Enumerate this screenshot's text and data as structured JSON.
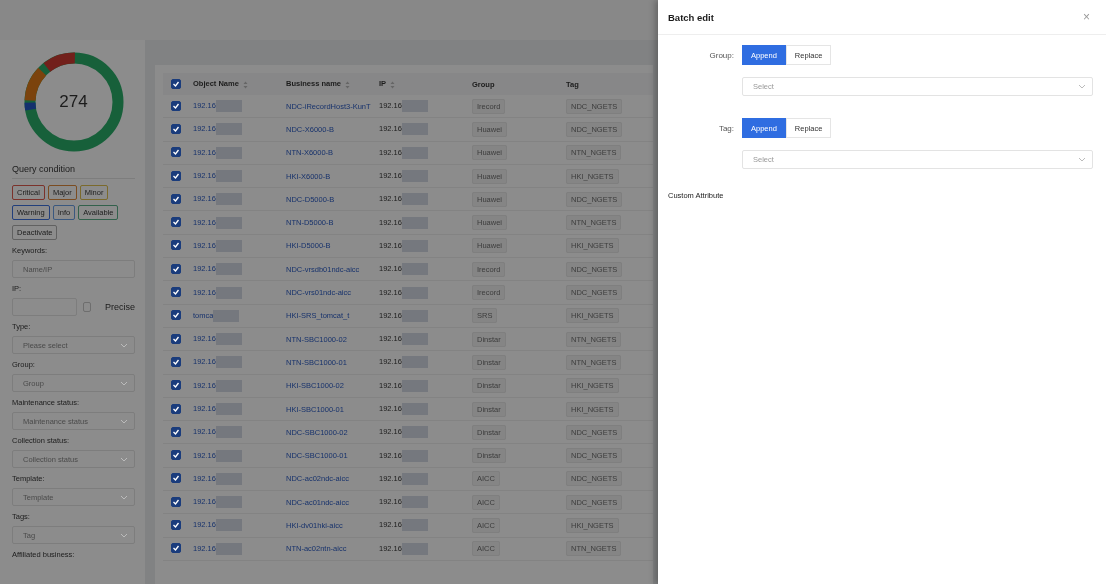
{
  "sidebar": {
    "total": "274",
    "query_title": "Query condition",
    "levels": [
      {
        "label": "Critical",
        "color": "#7b322b"
      },
      {
        "label": "Major",
        "color": "#7b4c21"
      },
      {
        "label": "Minor",
        "color": "#7b6a2c"
      },
      {
        "label": "Warning",
        "color": "#223f7b"
      },
      {
        "label": "Info",
        "color": "#3a587f"
      },
      {
        "label": "Available",
        "color": "#32614c"
      },
      {
        "label": "Deactivate",
        "color": "#616161"
      }
    ],
    "fields": [
      {
        "label": "Keywords:",
        "kind": "input",
        "placeholder": "Name/IP"
      },
      {
        "label": "IP:",
        "kind": "ip",
        "precise_label": "Precise",
        "precise_checked": false
      },
      {
        "label": "Type:",
        "kind": "select",
        "placeholder": "Please select"
      },
      {
        "label": "Group:",
        "kind": "select",
        "placeholder": "Group"
      },
      {
        "label": "Maintenance status:",
        "kind": "select",
        "placeholder": "Maintenance status"
      },
      {
        "label": "Collection status:",
        "kind": "select",
        "placeholder": "Collection status"
      },
      {
        "label": "Template:",
        "kind": "select",
        "placeholder": "Template"
      },
      {
        "label": "Tags:",
        "kind": "select",
        "placeholder": "Tag"
      },
      {
        "label": "Affiliated business:",
        "kind": "label"
      }
    ]
  },
  "table": {
    "all_checked": true,
    "columns": [
      {
        "label": "Object Name",
        "sortable": true
      },
      {
        "label": "Business name",
        "sortable": true
      },
      {
        "label": "IP",
        "sortable": true
      },
      {
        "label": "Group",
        "sortable": false
      },
      {
        "label": "Tag",
        "sortable": false
      }
    ],
    "rows": [
      {
        "selected": true,
        "object": "192.16",
        "business": "NDC-iRecordHost3-KunT",
        "ip": "192.16",
        "group": "Irecord",
        "tag": "NDC_NGETS"
      },
      {
        "selected": true,
        "object": "192.16",
        "business": "NDC-X6000-B",
        "ip": "192.16",
        "group": "Huawei",
        "tag": "NDC_NGETS"
      },
      {
        "selected": true,
        "object": "192.16",
        "business": "NTN-X6000-B",
        "ip": "192.16",
        "group": "Huawei",
        "tag": "NTN_NGETS"
      },
      {
        "selected": true,
        "object": "192.16",
        "business": "HKI-X6000-B",
        "ip": "192.16",
        "group": "Huawei",
        "tag": "HKI_NGETS"
      },
      {
        "selected": true,
        "object": "192.16",
        "business": "NDC-D5000-B",
        "ip": "192.16",
        "group": "Huawei",
        "tag": "NDC_NGETS"
      },
      {
        "selected": true,
        "object": "192.16",
        "business": "NTN-D5000-B",
        "ip": "192.16",
        "group": "Huawei",
        "tag": "NTN_NGETS"
      },
      {
        "selected": true,
        "object": "192.16",
        "business": "HKI-D5000-B",
        "ip": "192.16",
        "group": "Huawei",
        "tag": "HKI_NGETS"
      },
      {
        "selected": true,
        "object": "192.16",
        "business": "NDC-vrsdb01ndc-aicc",
        "ip": "192.16",
        "group": "Irecord",
        "tag": "NDC_NGETS"
      },
      {
        "selected": true,
        "object": "192.16",
        "business": "NDC-vrs01ndc-aicc",
        "ip": "192.16",
        "group": "Irecord",
        "tag": "NDC_NGETS"
      },
      {
        "selected": true,
        "object": "tomca",
        "business": "HKI-SRS_tomcat_t",
        "ip": "192.16",
        "group": "SRS",
        "tag": "HKI_NGETS"
      },
      {
        "selected": true,
        "object": "192.16",
        "business": "NTN-SBC1000-02",
        "ip": "192.16",
        "group": "Dinstar",
        "tag": "NTN_NGETS"
      },
      {
        "selected": true,
        "object": "192.16",
        "business": "NTN-SBC1000-01",
        "ip": "192.16",
        "group": "Dinstar",
        "tag": "NTN_NGETS"
      },
      {
        "selected": true,
        "object": "192.16",
        "business": "HKI-SBC1000-02",
        "ip": "192.16",
        "group": "Dinstar",
        "tag": "HKI_NGETS"
      },
      {
        "selected": true,
        "object": "192.16",
        "business": "HKI-SBC1000-01",
        "ip": "192.16",
        "group": "Dinstar",
        "tag": "HKI_NGETS"
      },
      {
        "selected": true,
        "object": "192.16",
        "business": "NDC-SBC1000-02",
        "ip": "192.16",
        "group": "Dinstar",
        "tag": "NDC_NGETS"
      },
      {
        "selected": true,
        "object": "192.16",
        "business": "NDC-SBC1000-01",
        "ip": "192.16",
        "group": "Dinstar",
        "tag": "NDC_NGETS"
      },
      {
        "selected": true,
        "object": "192.16",
        "business": "NDC-ac02ndc-aicc",
        "ip": "192.16",
        "group": "AICC",
        "tag": "NDC_NGETS"
      },
      {
        "selected": true,
        "object": "192.16",
        "business": "NDC-ac01ndc-aicc",
        "ip": "192.16",
        "group": "AICC",
        "tag": "NDC_NGETS"
      },
      {
        "selected": true,
        "object": "192.16",
        "business": "HKI-dv01hki-aicc",
        "ip": "192.16",
        "group": "AICC",
        "tag": "HKI_NGETS"
      },
      {
        "selected": true,
        "object": "192.16",
        "business": "NTN-ac02ntn-aicc",
        "ip": "192.16",
        "group": "AICC",
        "tag": "NTN_NGETS"
      }
    ]
  },
  "drawer": {
    "title": "Batch edit",
    "close": "×",
    "sections": [
      {
        "label": "Group:",
        "modes": [
          {
            "label": "Append",
            "selected": true
          },
          {
            "label": "Replace",
            "selected": false
          }
        ],
        "placeholder": "Select"
      },
      {
        "label": "Tag:",
        "modes": [
          {
            "label": "Append",
            "selected": true
          },
          {
            "label": "Replace",
            "selected": false
          }
        ],
        "placeholder": "Select"
      }
    ],
    "custom_attribute": "Custom Attribute"
  }
}
